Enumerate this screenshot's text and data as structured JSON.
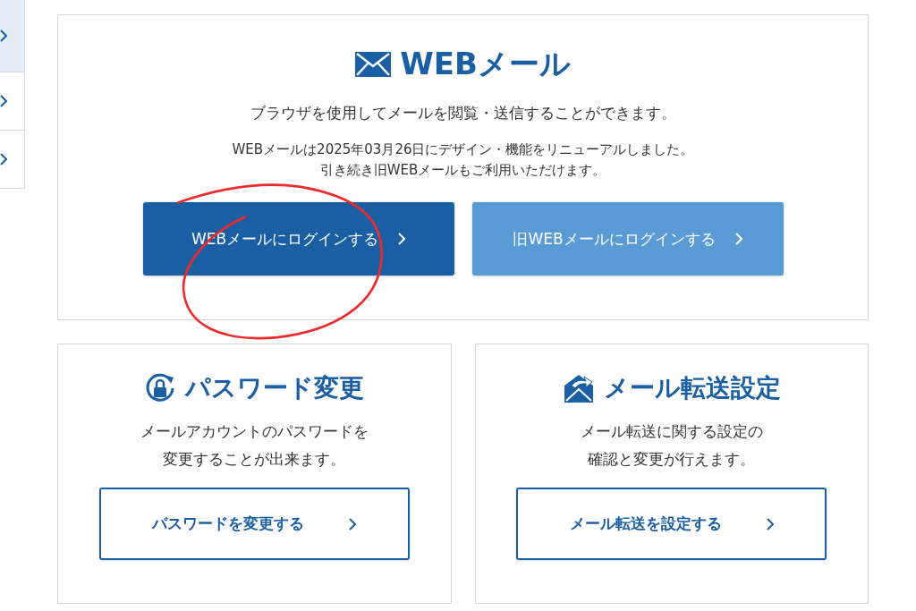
{
  "sidebar": {
    "items": [
      {
        "selected": true
      },
      {
        "selected": false
      },
      {
        "selected": false
      }
    ]
  },
  "webmail": {
    "title": "WEBメール",
    "description": "ブラウザを使用してメールを閲覧・送信することができます。",
    "notice": [
      "WEBメールは2025年03月26日にデザイン・機能をリニューアルしました。",
      "引き続き旧WEBメールもご利用いただけます。"
    ],
    "buttons": [
      {
        "label": "WEBメールにログインする",
        "kind": "primary"
      },
      {
        "label": "旧WEBメールにログインする",
        "kind": "secondary"
      }
    ]
  },
  "cards": [
    {
      "kind": "lock",
      "title": "パスワード変更",
      "description": [
        "メールアカウントのパスワードを",
        "変更することが出来ます。"
      ],
      "button": "パスワードを変更する"
    },
    {
      "kind": "forward",
      "title": "メール転送設定",
      "description": [
        "メール転送に関する設定の",
        "確認と変更が行えます。"
      ],
      "button": "メール転送を設定する"
    }
  ]
}
